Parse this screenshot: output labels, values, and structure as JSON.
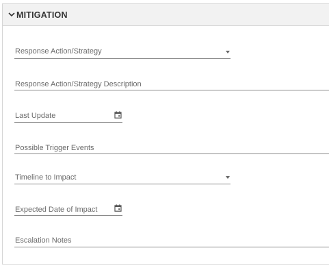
{
  "section": {
    "title": "MITIGATION",
    "collapse_icon": "chevron-down-icon"
  },
  "fields": {
    "response_action": {
      "label": "Response Action/Strategy",
      "type": "select",
      "value": "",
      "icon": "dropdown-arrow-icon"
    },
    "response_description": {
      "label": "Response Action/Strategy Description",
      "type": "text",
      "value": ""
    },
    "last_update": {
      "label": "Last Update",
      "type": "date",
      "value": "",
      "icon": "calendar-icon"
    },
    "trigger_events": {
      "label": "Possible Trigger Events",
      "type": "text",
      "value": ""
    },
    "timeline_to_impact": {
      "label": "Timeline to Impact",
      "type": "select",
      "value": "",
      "icon": "dropdown-arrow-icon"
    },
    "expected_date": {
      "label": "Expected Date of Impact",
      "type": "date",
      "value": "",
      "icon": "calendar-icon"
    },
    "escalation_notes": {
      "label": "Escalation Notes",
      "type": "text",
      "value": ""
    }
  },
  "colors": {
    "header_bg": "#f2f2f2",
    "border": "#d6d6d6",
    "label": "#6b6b6b",
    "underline": "#8a8a8a"
  }
}
